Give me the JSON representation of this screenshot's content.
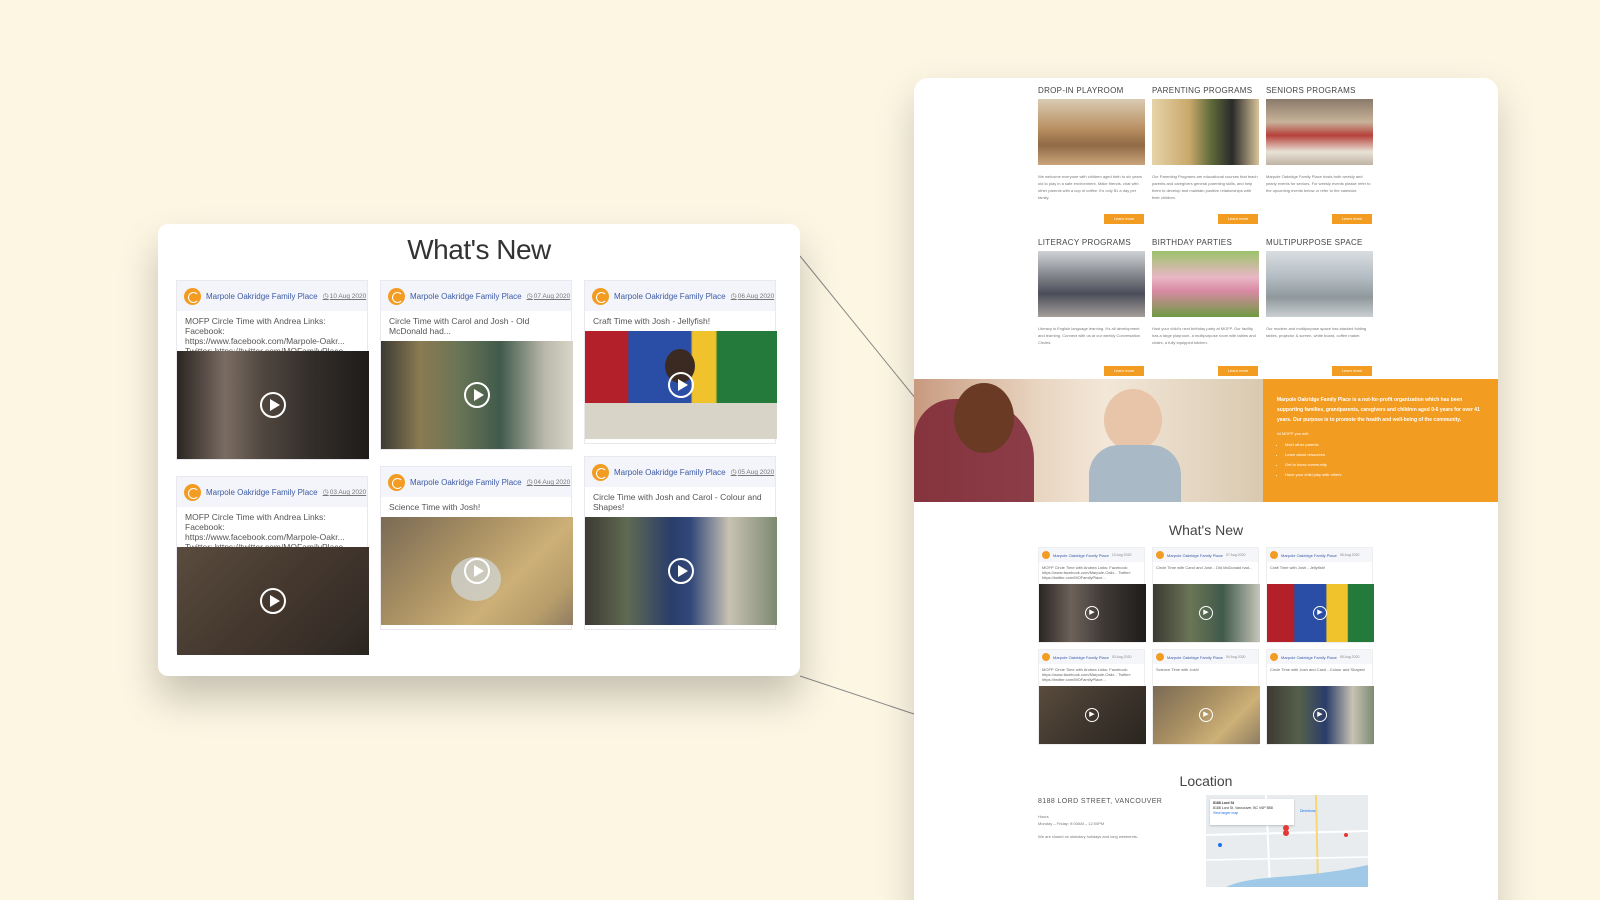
{
  "programs": [
    {
      "title": "DROP-IN PLAYROOM",
      "text": "We welcome everyone with children aged birth to six years old to play in a safe environment. Make friends, chat with other parents with a cup of coffee. It's only $1 a day per family.",
      "button": "Learn more"
    },
    {
      "title": "PARENTING PROGRAMS",
      "text": "Our Parenting Programs are educational courses that teach parents and caregivers general parenting skills, and help them to develop and maintain positive relationships with their children.",
      "button": "Learn more"
    },
    {
      "title": "SENIORS PROGRAMS",
      "text": "Marpole Oakridge Family Place hosts both weekly and yearly events for seniors. For weekly events please refer to the upcoming events below or refer to the calendar.",
      "button": "Learn more"
    },
    {
      "title": "LITERACY PROGRAMS",
      "text": "Literacy is English language learning. It's all development and learning. Connect with us at our weekly Conversation Circles.",
      "button": "Learn more"
    },
    {
      "title": "BIRTHDAY PARTIES",
      "text": "Host your child's next birthday party at MOFP. Our facility has a large playroom, a multipurpose room with tables and chairs, a fully equipped kitchen.",
      "button": "Learn more"
    },
    {
      "title": "MULTIPURPOSE SPACE",
      "text": "Our modern and multipurpose space has stacked folding tables, projector & screen, white board, coffee maker.",
      "button": "Learn more"
    }
  ],
  "hero": {
    "lead": "Marpole Oakridge Family Place is a not-for-profit organization which has been supporting families, grandparents, caregivers and children aged 0-6 years for over 41 years. Our purpose is to promote the health and well-being of the community.",
    "sub": "At MOFP you will:",
    "list": [
      "Meet other parents",
      "Learn about resources",
      "Get to know community",
      "Have your child play with others"
    ]
  },
  "whats_new": {
    "title": "What's New",
    "author": "Marpole Oakridge Family Place",
    "posts": [
      {
        "date": "10 Aug 2020",
        "text": "MOFP Circle Time with Andrea Links: Facebook: https://www.facebook.com/Marpole-Oakr... Twitter: https://twitter.com/MOFamilyPlace..."
      },
      {
        "date": "07 Aug 2020",
        "text": "Circle Time with Carol and Josh - Old McDonald had..."
      },
      {
        "date": "06 Aug 2020",
        "text": "Craft Time with Josh - Jellyfish!"
      },
      {
        "date": "03 Aug 2020",
        "text": "MOFP Circle Time with Andrea Links: Facebook: https://www.facebook.com/Marpole-Oakr... Twitter: https://twitter.com/MOFamilyPlace..."
      },
      {
        "date": "04 Aug 2020",
        "text": "Science Time with Josh!"
      },
      {
        "date": "05 Aug 2020",
        "text": "Circle Time with Josh and Carol - Colour and Shapes!"
      }
    ]
  },
  "location": {
    "title": "Location",
    "address": "8188 LORD STREET, VANCOUVER",
    "hours_label": "Hours",
    "hours": "Monday – Friday: 9:00AM – 12:00PM",
    "note": "We are closed on statutory holidays and long weekends.",
    "map_place": "8188 Lord St",
    "map_place_address": "8188 Lord St, Vancouver, BC V6P 5B8",
    "map_link": "View larger map",
    "map_directions": "Directions"
  },
  "colors": {
    "accent": "#f39c22",
    "link": "#3b5ba5",
    "background": "#fdf6e3"
  },
  "icons": [
    "play-icon",
    "clock-icon",
    "avatar-logo-icon",
    "map-pin-icon"
  ]
}
